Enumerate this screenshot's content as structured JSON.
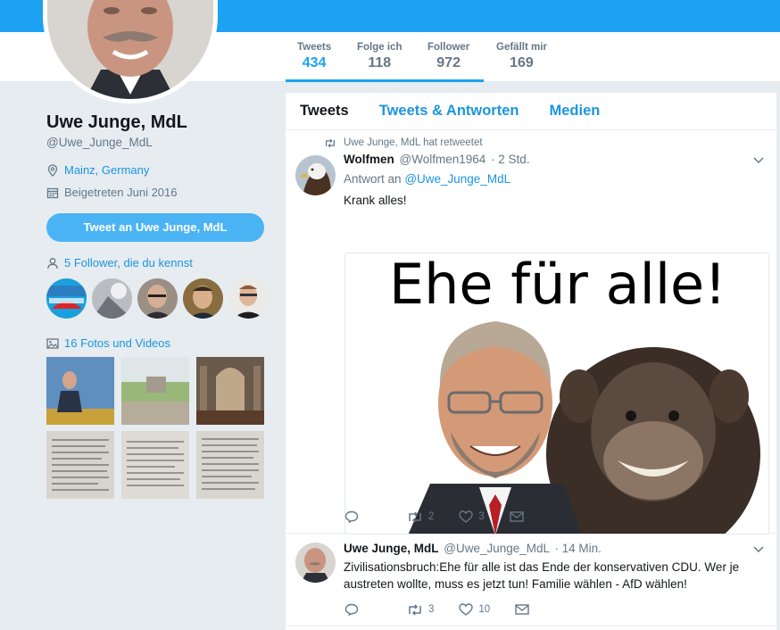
{
  "profile": {
    "name": "Uwe Junge, MdL",
    "handle": "@Uwe_Junge_MdL",
    "location": "Mainz, Germany",
    "joined": "Beigetreten Juni 2016",
    "tweet_to_label": "Tweet an Uwe Junge, MdL",
    "followers_you_know": "5 Follower, die du kennst",
    "photos_videos": "16 Fotos und Videos"
  },
  "stats": [
    {
      "label": "Tweets",
      "value": "434"
    },
    {
      "label": "Folge ich",
      "value": "118"
    },
    {
      "label": "Follower",
      "value": "972"
    },
    {
      "label": "Gefällt mir",
      "value": "169"
    }
  ],
  "tabs": [
    "Tweets",
    "Tweets & Antworten",
    "Medien"
  ],
  "tweets": [
    {
      "retweet_note": "Uwe Junge, MdL hat retweetet",
      "author": "Wolfmen",
      "handle": "@Wolfmen1964",
      "time": "· 2 Std.",
      "reply_prefix": "Antwort an",
      "reply_handle": "@Uwe_Junge_MdL",
      "text": "Krank alles!",
      "media_caption": "Ehe für alle!",
      "retweets": "2",
      "likes": "3"
    },
    {
      "author": "Uwe Junge, MdL",
      "handle": "@Uwe_Junge_MdL",
      "time": "· 14 Min.",
      "text": "Zivilisationsbruch:Ehe für alle ist das Ende der konservativen CDU. Wer je austreten wollte, muss es jetzt tun! Familie wählen - AfD wählen!",
      "retweets": "3",
      "likes": "10"
    }
  ],
  "colors": {
    "accent": "#1da1f2",
    "link": "#1b95e0",
    "button": "#4ab3f4",
    "background": "#e6ecf0",
    "muted": "#657786"
  }
}
